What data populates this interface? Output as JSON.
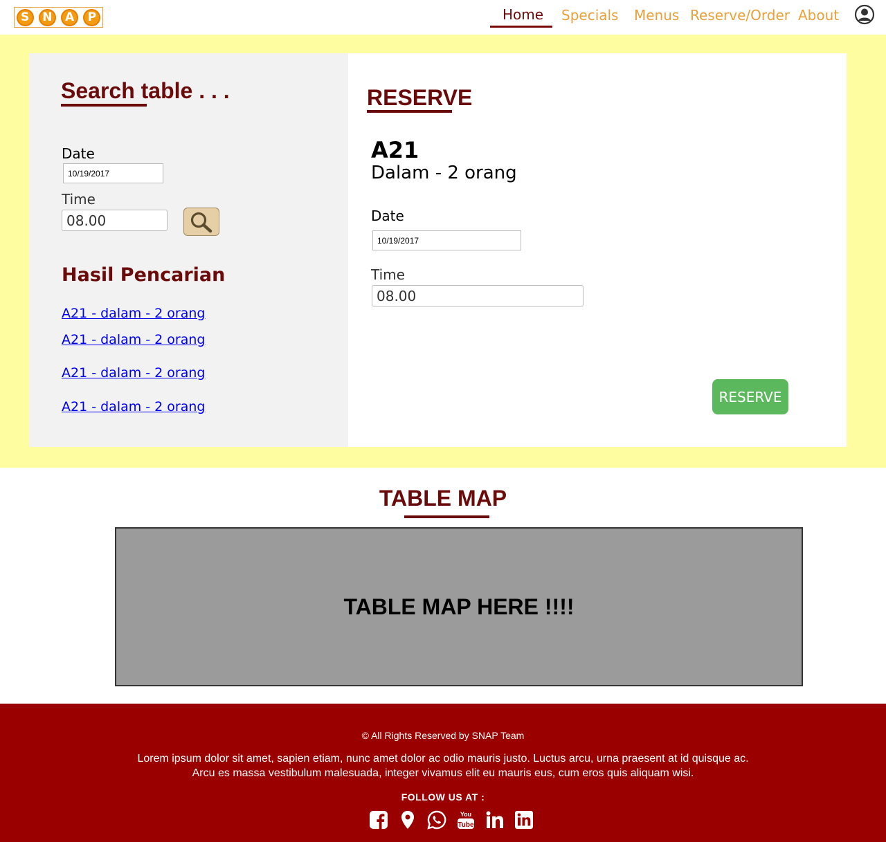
{
  "brand": {
    "letters": [
      "S",
      "N",
      "A",
      "P"
    ],
    "accent": "#f39c12"
  },
  "nav": {
    "items": [
      {
        "label": "Home",
        "active": true
      },
      {
        "label": "Specials"
      },
      {
        "label": "Menus"
      },
      {
        "label": "Reserve/Order"
      },
      {
        "label": "About"
      }
    ],
    "user_icon": "user-circle-icon"
  },
  "search": {
    "title": "Search table . . .",
    "date_label": "Date",
    "date_value": "10/19/2017",
    "time_label": "Time",
    "time_value": "08.00",
    "button_icon": "magnifier-icon",
    "results_title": "Hasil Pencarian",
    "results": [
      "A21 - dalam - 2 orang",
      "A21 - dalam - 2 orang",
      "A21 - dalam - 2 orang",
      "A21 - dalam - 2 orang"
    ]
  },
  "reserve": {
    "title": "RESERVE",
    "table_code": "A21",
    "table_desc": "Dalam - 2 orang",
    "date_label": "Date",
    "date_value": "10/19/2017",
    "time_label": "Time",
    "time_value": "08.00",
    "button_label": "RESERVE"
  },
  "table_map": {
    "title": "TABLE MAP",
    "placeholder": "TABLE MAP HERE !!!!"
  },
  "footer": {
    "copyright": "© All Rights Reserved by SNAP Team",
    "lorem_line1": "Lorem ipsum dolor sit amet, sapien etiam, nunc amet dolor ac odio mauris justo. Luctus arcu, urna praesent at id quisque ac.",
    "lorem_line2": "Arcu es massa vestibulum malesuada, integer vivamus elit eu mauris eus, cum eros quis aliquam wisi.",
    "follow": "FOLLOW US AT :",
    "socials": [
      "facebook-icon",
      "map-pin-icon",
      "whatsapp-icon",
      "youtube-icon",
      "linkedin-icon",
      "linkedin-square-icon"
    ]
  },
  "colors": {
    "band": "#fefea0",
    "heading": "#6b0a0a",
    "nav_link": "#e8a13a",
    "reserve_button": "#5cb85c",
    "footer": "#9b0000"
  }
}
